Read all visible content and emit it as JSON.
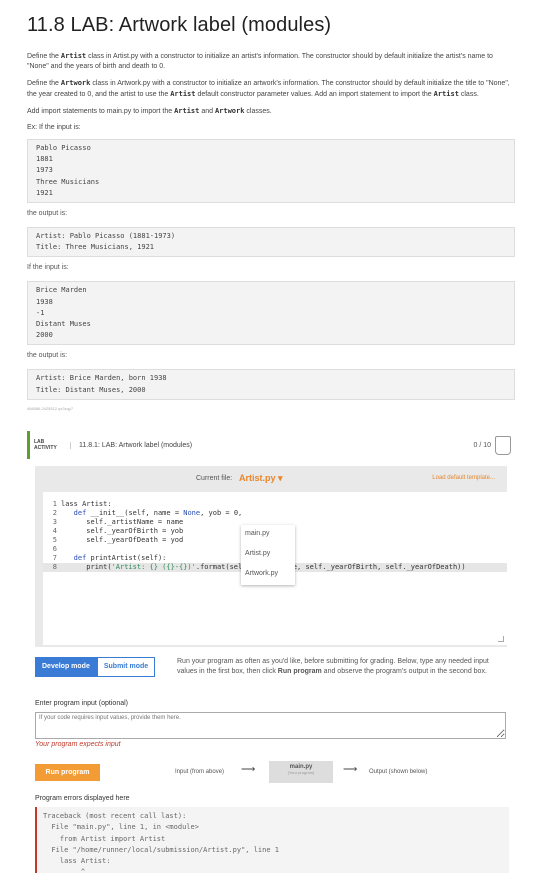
{
  "title": "11.8 LAB: Artwork label (modules)",
  "desc": {
    "p1_a": "Define the ",
    "p1_code": "Artist",
    "p1_b": " class in Artist.py with a constructor to initialize an artist's information. The constructor should by default initialize the artist's name to \"None\" and the years of birth and death to 0.",
    "p2_a": "Define the ",
    "p2_code": "Artwork",
    "p2_b": " class in Artwork.py with a constructor to initialize an artwork's information. The constructor should by default initialize the title to \"None\", the year created to 0, and the artist to use the ",
    "p2_code2": "Artist",
    "p2_c": " default constructor parameter values. Add an import statement to import the ",
    "p2_code3": "Artist",
    "p2_d": " class.",
    "p3_a": "Add import statements to main.py to import the ",
    "p3_code": "Artist",
    "p3_b": " and ",
    "p3_code2": "Artwork",
    "p3_c": " classes.",
    "ex_label": "Ex: If the input is:",
    "ex1_input": "Pablo Picasso\n1881\n1973\nThree Musicians\n1921",
    "output_label": "the output is:",
    "ex1_output": "Artist: Pablo Picasso (1881-1973)\nTitle: Three Musicians, 1921",
    "if_input_label": "If the input is:",
    "ex2_input": "Brice Marden\n1938\n-1\nDistant Muses\n2000",
    "output_label2": "the output is:",
    "ex2_output": "Artist: Brice Marden, born 1938\nTitle: Distant Muses, 2000",
    "tiny_id": "466086.2425512.qx3zqy7"
  },
  "lab": {
    "tag": "LAB ACTIVITY",
    "title": "11.8.1: LAB: Artwork label (modules)",
    "score": "0 / 10",
    "current_file_label": "Current file:",
    "current_file": "Artist.py ▾",
    "load_default": "Load default template...",
    "files": [
      "main.py",
      "Artist.py",
      "Artwork.py"
    ],
    "line_numbers": [
      "1",
      "2",
      "3",
      "4",
      "5",
      "6",
      "7",
      "8"
    ],
    "mode_develop": "Develop mode",
    "mode_submit": "Submit mode",
    "mode_desc_a": "Run your program as often as you'd like, before submitting for grading. Below, type any needed input values in the first box, then click ",
    "mode_desc_bold": "Run program",
    "mode_desc_b": " and observe the program's output in the second box.",
    "input_label": "Enter program input (optional)",
    "input_placeholder": "If your code requires input values, provide them here.",
    "expects_input": "Your program expects input",
    "run_button": "Run program",
    "flow_input": "Input (from above)",
    "flow_main": "main.py",
    "flow_main_sub": "(Your program)",
    "flow_output": "Output (shown below)",
    "errors_label": "Program errors displayed here",
    "errors_text": "Traceback (most recent call last):\n  File \"main.py\", line 1, in <module>\n    from Artist import Artist\n  File \"/home/runner/local/submission/Artist.py\", line 1\n    lass Artist:\n         ^"
  },
  "code": {
    "l1": "lass Artist:",
    "l2_a": "   ",
    "l2_def": "def",
    "l2_b": " __init__(self, name = ",
    "l2_none": "None",
    "l2_c": ", yob = 0,",
    "l3": "      self._artistName = name",
    "l4": "      self._yearOfBirth = yob",
    "l5": "      self._yearOfDeath = yod",
    "l6": "",
    "l7_a": "   ",
    "l7_def": "def",
    "l7_b": " printArtist(self):",
    "l8_a": "      print(",
    "l8_str": "'Artist: {} ({}-{})'",
    "l8_b": ".format(self._artistName, self._yearOfBirth, self._yearOfDeath))"
  }
}
